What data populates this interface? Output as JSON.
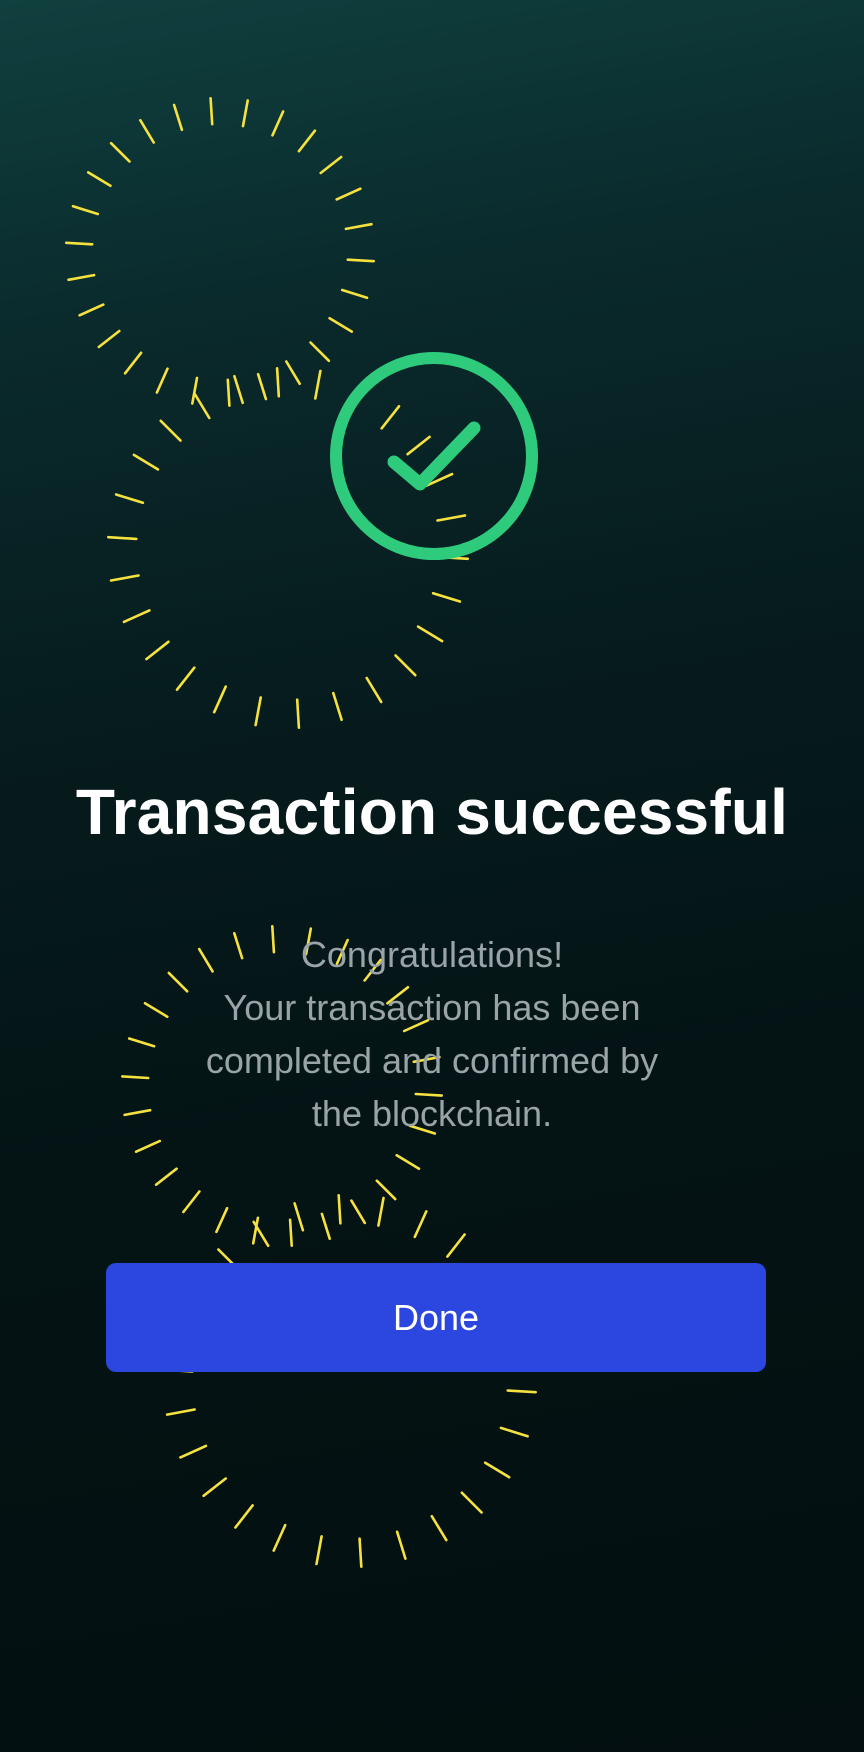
{
  "screen": {
    "title": "Transaction successful",
    "message_lines": [
      "Congratulations!",
      "Your transaction has been",
      "completed and confirmed by",
      "the blockchain."
    ],
    "done_label": "Done"
  },
  "icons": {
    "success": "check-circle-icon",
    "confetti": "confetti-burst-icon"
  },
  "colors": {
    "success_green": "#2fcb7c",
    "button_blue": "#2c47e0",
    "confetti_yellow": "#f6e23f",
    "title_white": "#ffffff",
    "message_gray": "#9aa4a8"
  }
}
